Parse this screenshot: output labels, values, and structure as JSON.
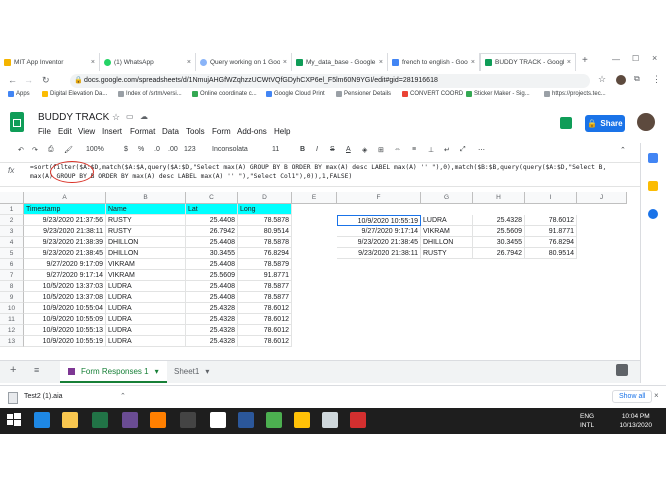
{
  "browser": {
    "tabs": [
      {
        "title": "MIT App Inventor",
        "color": "#f4b400"
      },
      {
        "title": "(1) WhatsApp",
        "color": "#25d366"
      },
      {
        "title": "Query working on 1 Goo...",
        "color": "#8ab4f8"
      },
      {
        "title": "My_data_base - Google...",
        "color": "#0f9d58"
      },
      {
        "title": "french to english - Goo...",
        "color": "#4285f4"
      },
      {
        "title": "BUDDY TRACK - Google...",
        "color": "#0f9d58"
      }
    ],
    "url": "docs.google.com/spreadsheets/d/1NmujAHGfWZqhzzUCWtVQfGDyhCXP6el_F5lm60N9YGI/edit#gid=281916618",
    "bookmarks": [
      "Apps",
      "Digital Elevation Da...",
      "Index of /srtm/versi...",
      "Online coordinate c...",
      "Google Cloud Print",
      "Pensioner Details",
      "CONVERT COORD",
      "Sticker Maker - Sig...",
      "https://projects.tec..."
    ]
  },
  "sheet": {
    "title": "BUDDY TRACK",
    "menus": [
      "File",
      "Edit",
      "View",
      "Insert",
      "Format",
      "Data",
      "Tools",
      "Form",
      "Add-ons",
      "Help"
    ],
    "share_label": "Share",
    "toolbar": {
      "zoom": "100%",
      "currency": "$",
      "percent": "%",
      "dec1": ".0",
      "dec2": ".00",
      "numfmt": "123",
      "font": "Inconsolata",
      "size": "11"
    },
    "fx": "fx",
    "formula_line1": "=sort(filter($A:$D,match($A:$A,query($A:$D,\"Select max(A) GROUP BY B ORDER BY max(A) desc LABEL max(A) '' \"),0),match($B:$B,query(query($A:$D,\"Select B,",
    "formula_line2": "max(A) GROUP BY B ORDER BY max(A) desc LABEL max(A) '' \"),\"Select Col1\"),0)),1,FALSE)",
    "columns": [
      "A",
      "B",
      "C",
      "D",
      "E",
      "F",
      "G",
      "H",
      "I",
      "J"
    ],
    "rows": [
      "1",
      "2",
      "3",
      "4",
      "5",
      "6",
      "7",
      "8",
      "9",
      "10",
      "11",
      "12",
      "13"
    ],
    "headers": [
      "Timestamp",
      "Name",
      "Lat",
      "Long"
    ],
    "data": [
      [
        "9/23/2020 21:37:56",
        "RUSTY",
        "25.4408",
        "78.5878"
      ],
      [
        "9/23/2020 21:38:11",
        "RUSTY",
        "26.7942",
        "80.9514"
      ],
      [
        "9/23/2020 21:38:39",
        "DHILLON",
        "25.4408",
        "78.5878"
      ],
      [
        "9/23/2020 21:38:45",
        "DHILLON",
        "30.3455",
        "76.8294"
      ],
      [
        "9/27/2020 9:17:09",
        "VIKRAM",
        "25.4408",
        "78.5879"
      ],
      [
        "9/27/2020 9:17:14",
        "VIKRAM",
        "25.5609",
        "91.8771"
      ],
      [
        "10/5/2020 13:37:03",
        "LUDRA",
        "25.4408",
        "78.5877"
      ],
      [
        "10/5/2020 13:37:08",
        "LUDRA",
        "25.4408",
        "78.5877"
      ],
      [
        "10/9/2020 10:55:04",
        "LUDRA",
        "25.4328",
        "78.6012"
      ],
      [
        "10/9/2020 10:55:09",
        "LUDRA",
        "25.4328",
        "78.6012"
      ],
      [
        "10/9/2020 10:55:13",
        "LUDRA",
        "25.4328",
        "78.6012"
      ],
      [
        "10/9/2020 10:55:19",
        "LUDRA",
        "25.4328",
        "78.6012"
      ]
    ],
    "results": [
      [
        "10/9/2020 10:55:19",
        "LUDRA",
        "25.4328",
        "78.6012"
      ],
      [
        "9/27/2020 9:17:14",
        "VIKRAM",
        "25.5609",
        "91.8771"
      ],
      [
        "9/23/2020 21:38:45",
        "DHILLON",
        "30.3455",
        "76.8294"
      ],
      [
        "9/23/2020 21:38:11",
        "RUSTY",
        "26.7942",
        "80.9514"
      ]
    ],
    "sheet_tabs": [
      "Form Responses 1",
      "Sheet1"
    ]
  },
  "downloads": {
    "file": "Test2 (1).aia",
    "show_all": "Show all"
  },
  "taskbar": {
    "lang1": "ENG",
    "lang2": "INTL",
    "time": "10:04 PM",
    "date": "10/13/2020"
  }
}
